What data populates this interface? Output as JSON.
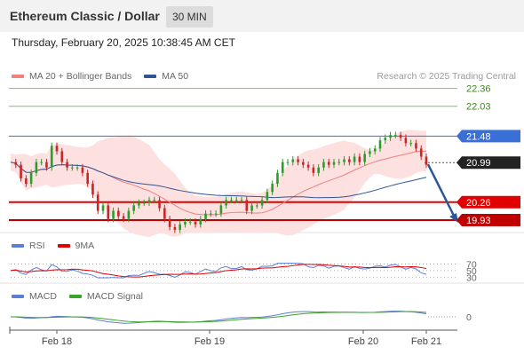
{
  "header": {
    "title": "Ethereum Classic / Dollar",
    "timeframe": "30 MIN"
  },
  "datetime": "Thursday, February 20, 2025 10:38:45 AM CET",
  "legend_main": [
    {
      "label": "MA 20 + Bollinger Bands",
      "color": "#f08080"
    },
    {
      "label": "MA 50",
      "color": "#2e5597"
    }
  ],
  "copyright": "Research © 2025 Trading Central",
  "price_levels": [
    {
      "value": "22.36",
      "kind": "resistance-green",
      "color": "#3a8a1a"
    },
    {
      "value": "22.03",
      "kind": "resistance-green",
      "color": "#3a8a1a"
    },
    {
      "value": "21.48",
      "kind": "pivot",
      "color": "#3a6fd8"
    },
    {
      "value": "20.99",
      "kind": "last-price",
      "color": "#222222"
    },
    {
      "value": "20.26",
      "kind": "support",
      "color": "#e00000"
    },
    {
      "value": "19.93",
      "kind": "support",
      "color": "#c00000"
    }
  ],
  "legend_rsi": [
    {
      "label": "RSI",
      "color": "#5b7fd6"
    },
    {
      "label": "9MA",
      "color": "#e00000"
    }
  ],
  "rsi_levels": [
    "70",
    "50",
    "30"
  ],
  "legend_macd": [
    {
      "label": "MACD",
      "color": "#5b7fd6"
    },
    {
      "label": "MACD Signal",
      "color": "#3aa32a"
    }
  ],
  "macd_level": "0",
  "x_axis": [
    "Feb 18",
    "Feb 19",
    "Feb 20",
    "Feb 21"
  ],
  "chart_data": {
    "type": "candlestick",
    "symbol": "ETC/USD",
    "interval": "30 MIN",
    "ylim": [
      19.7,
      22.55
    ],
    "x_ticks": [
      "Feb 18",
      "Feb 19",
      "Feb 20",
      "Feb 21"
    ],
    "forecast": {
      "from": 20.99,
      "to": 19.93,
      "direction": "down"
    },
    "horizontal_levels": [
      22.36,
      22.03,
      21.48,
      20.99,
      20.26,
      19.93
    ],
    "close": [
      21.0,
      20.95,
      20.7,
      20.6,
      20.8,
      21.0,
      21.0,
      20.9,
      21.3,
      21.2,
      21.0,
      20.9,
      20.9,
      20.9,
      20.8,
      20.6,
      20.4,
      20.1,
      20.2,
      19.95,
      20.1,
      20.0,
      19.95,
      20.1,
      20.2,
      20.25,
      20.25,
      20.3,
      20.3,
      20.15,
      19.95,
      19.8,
      19.75,
      19.85,
      19.9,
      19.9,
      19.85,
      19.95,
      20.05,
      20.05,
      20.05,
      20.2,
      20.3,
      20.3,
      20.3,
      20.3,
      20.1,
      20.2,
      20.2,
      20.3,
      20.45,
      20.6,
      20.8,
      21.0,
      21.0,
      21.05,
      21.0,
      20.95,
      20.9,
      20.8,
      20.9,
      21.0,
      20.95,
      21.0,
      21.0,
      21.05,
      21.0,
      21.1,
      21.0,
      21.15,
      21.2,
      21.25,
      21.4,
      21.45,
      21.5,
      21.5,
      21.45,
      21.35,
      21.35,
      21.25,
      21.1,
      20.95
    ]
  }
}
